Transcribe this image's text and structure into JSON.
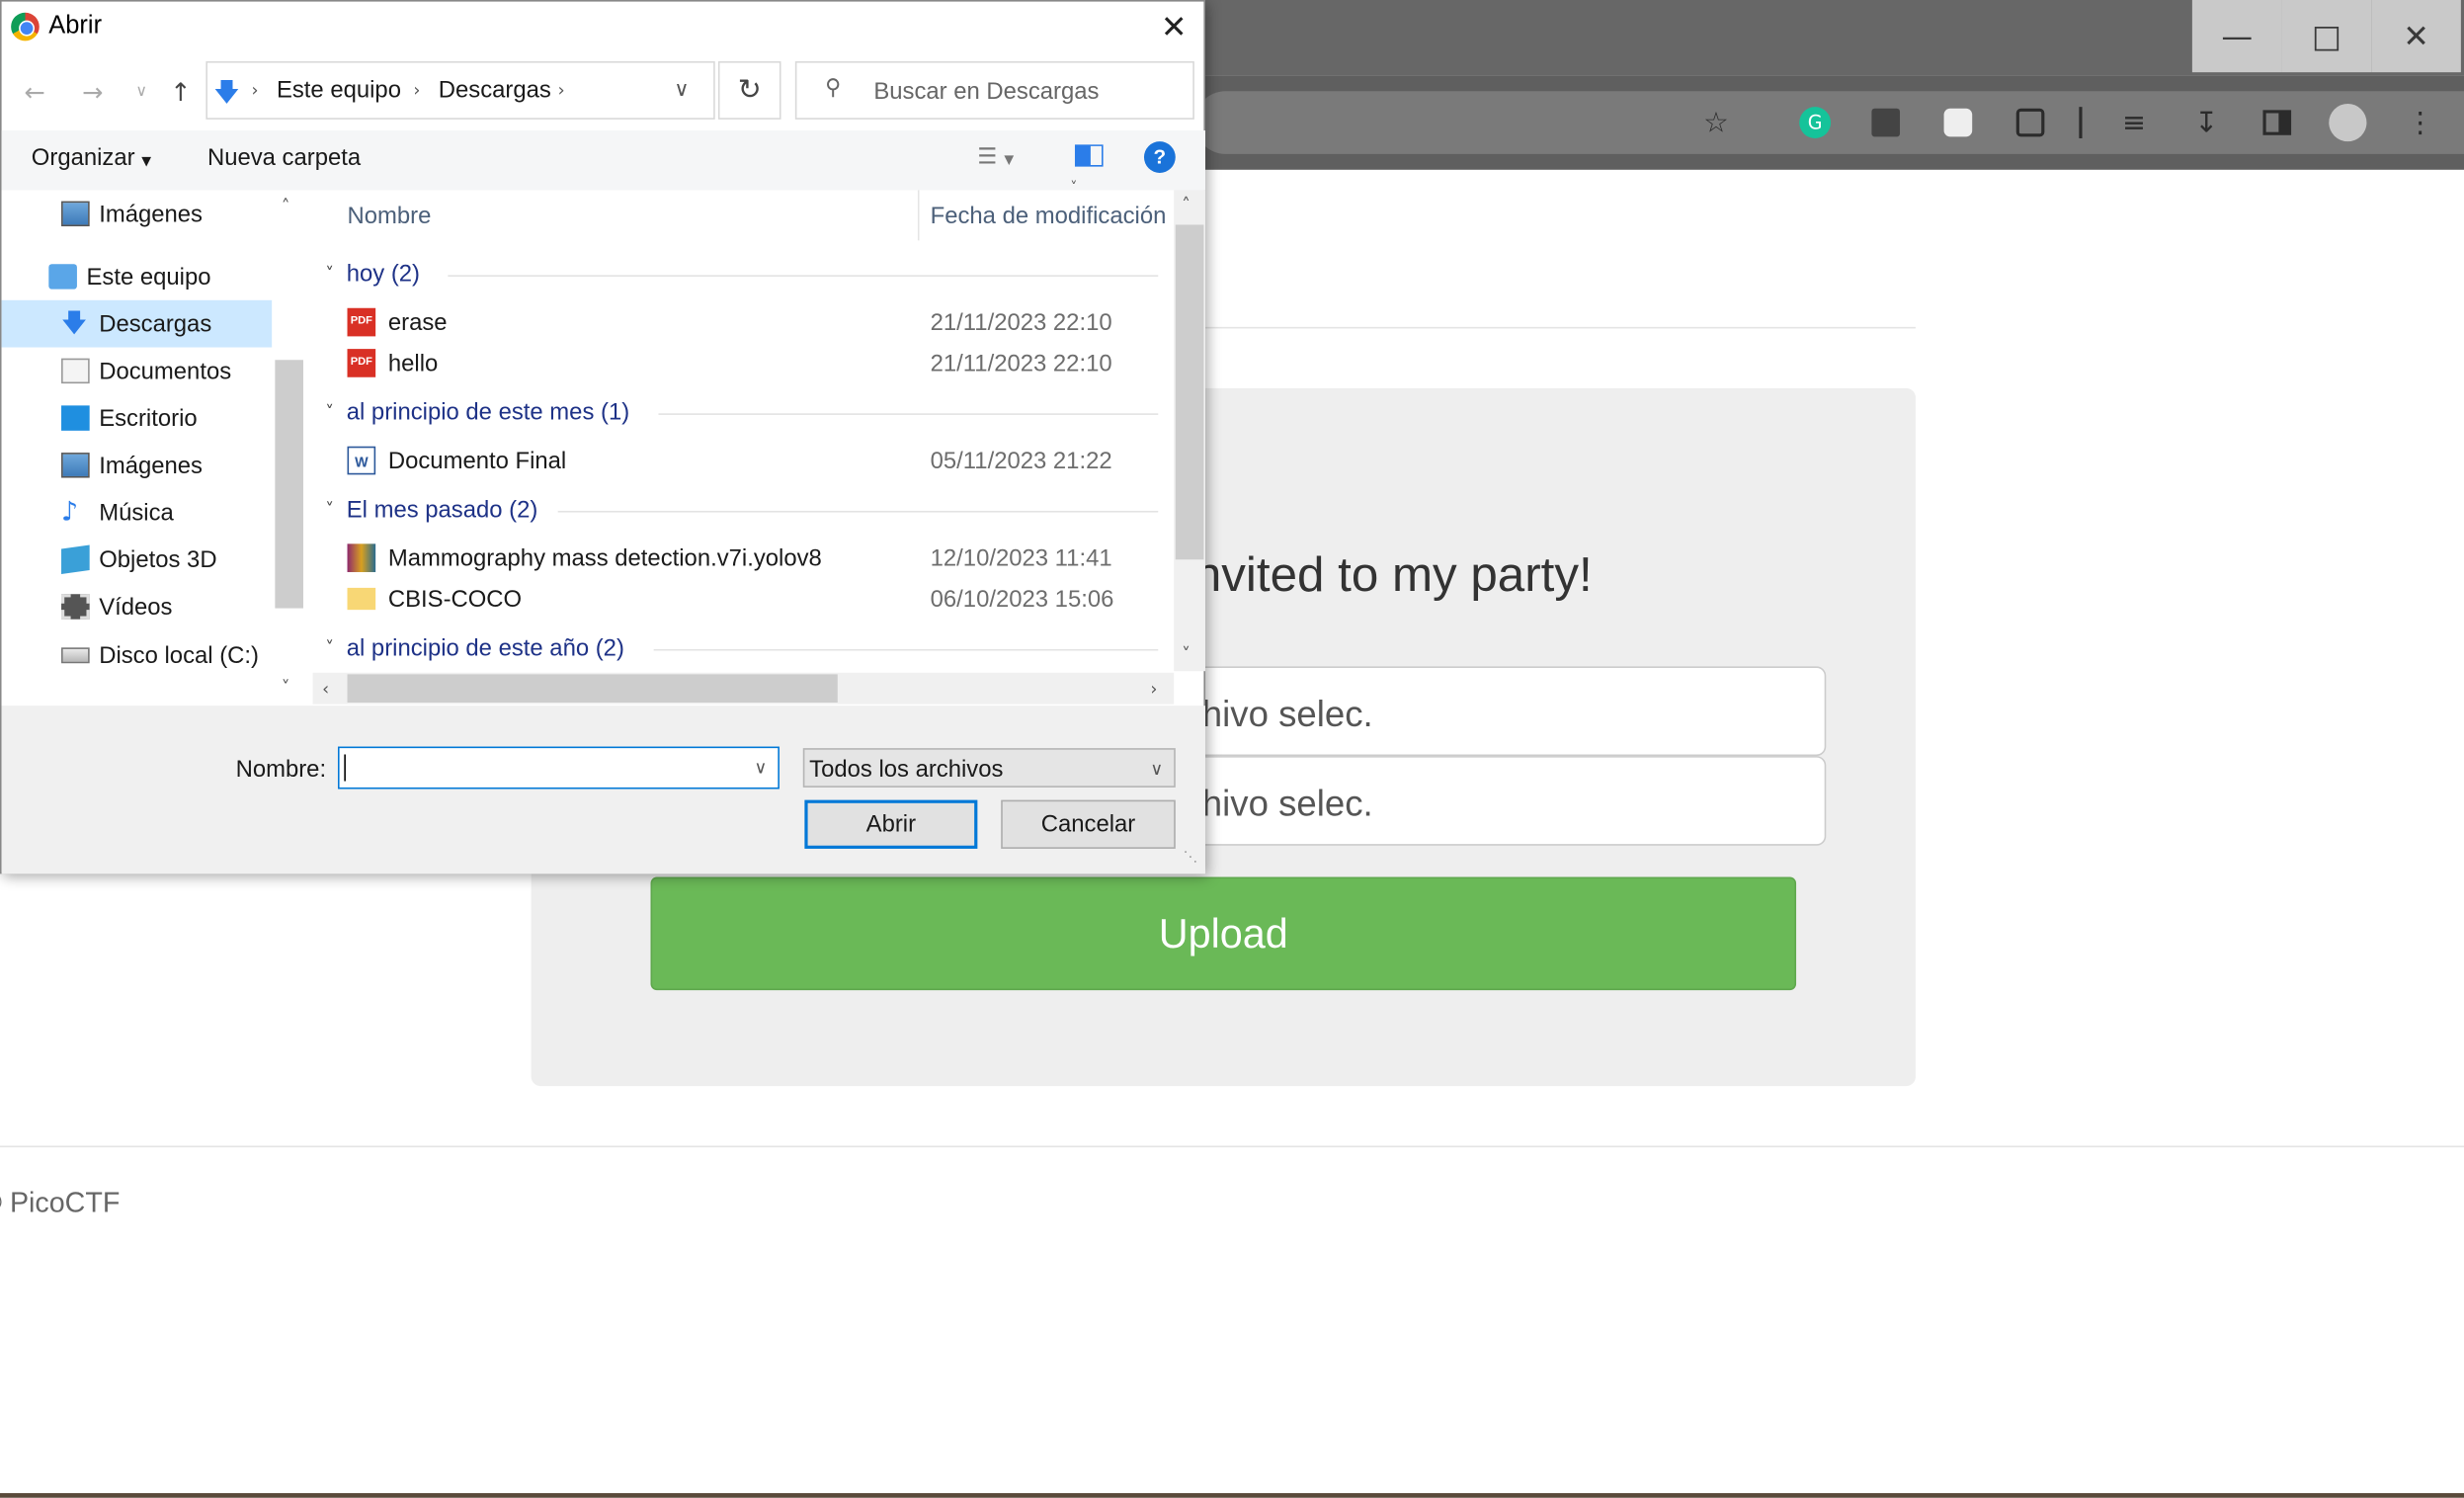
{
  "dialog": {
    "title": "Abrir",
    "breadcrumb": [
      "Este equipo",
      "Descargas"
    ],
    "search_placeholder": "Buscar en Descargas",
    "toolbar": {
      "organize": "Organizar",
      "new_folder": "Nueva carpeta"
    },
    "sidebar": {
      "items": [
        {
          "label": "Imágenes",
          "icon": "pictures-icon"
        },
        {
          "label": "Este equipo",
          "icon": "computer-icon"
        },
        {
          "label": "Descargas",
          "icon": "downloads-icon",
          "selected": true
        },
        {
          "label": "Documentos",
          "icon": "documents-icon"
        },
        {
          "label": "Escritorio",
          "icon": "desktop-icon"
        },
        {
          "label": "Imágenes",
          "icon": "pictures-icon"
        },
        {
          "label": "Música",
          "icon": "music-icon"
        },
        {
          "label": "Objetos 3D",
          "icon": "3d-objects-icon"
        },
        {
          "label": "Vídeos",
          "icon": "videos-icon"
        },
        {
          "label": "Disco local (C:)",
          "icon": "drive-icon"
        }
      ]
    },
    "columns": {
      "name": "Nombre",
      "date": "Fecha de modificación"
    },
    "groups": [
      {
        "label": "hoy (2)",
        "files": [
          {
            "name": "erase",
            "date": "21/11/2023 22:10",
            "type": "pdf"
          },
          {
            "name": "hello",
            "date": "21/11/2023 22:10",
            "type": "pdf"
          }
        ]
      },
      {
        "label": "al principio de este mes (1)",
        "files": [
          {
            "name": "Documento Final",
            "date": "05/11/2023 21:22",
            "type": "word"
          }
        ]
      },
      {
        "label": "El mes pasado (2)",
        "files": [
          {
            "name": "Mammography mass detection.v7i.yolov8",
            "date": "12/10/2023 11:41",
            "type": "archive"
          },
          {
            "name": "CBIS-COCO",
            "date": "06/10/2023 15:06",
            "type": "folder"
          }
        ]
      },
      {
        "label": "al principio de este año (2)",
        "files": []
      }
    ],
    "filename_label": "Nombre:",
    "filename_value": "",
    "filter": "Todos los archivos",
    "open_button": "Abrir",
    "cancel_button": "Cancelar"
  },
  "page": {
    "party_text": "nvited to my party!",
    "file_input_1": "hivo selec.",
    "file_input_2": "hivo selec.",
    "upload_button": "Upload",
    "footer": "© PicoCTF"
  },
  "colors": {
    "upload_green": "#6ab957",
    "selection": "#cce8ff",
    "group_blue": "#1e3287"
  }
}
